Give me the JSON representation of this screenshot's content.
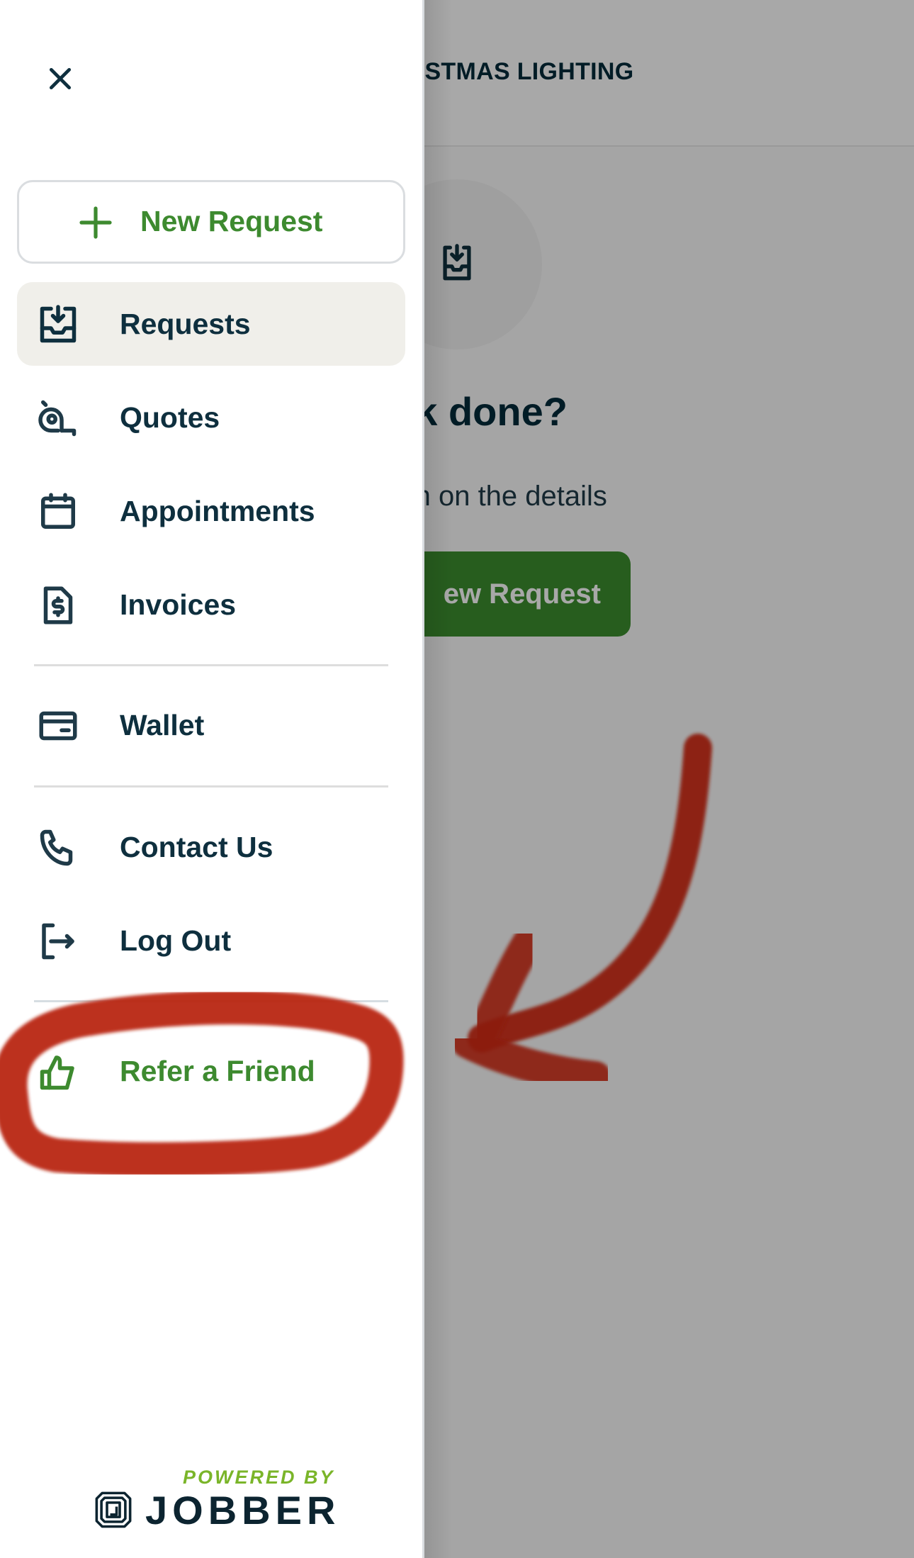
{
  "background_page": {
    "header_title": "HRISTMAS LIGHTING",
    "empty_state": {
      "icon": "inbox-download-icon",
      "title": "e work done?",
      "subtitle": "to fill us in on the details",
      "button_label": "ew Request"
    }
  },
  "drawer": {
    "close_icon": "close-icon",
    "new_request": {
      "icon": "plus-icon",
      "label": "New Request"
    },
    "nav_items": [
      {
        "id": "requests",
        "label": "Requests",
        "icon": "inbox-download-icon",
        "active": true
      },
      {
        "id": "quotes",
        "label": "Quotes",
        "icon": "tape-measure-icon",
        "active": false
      },
      {
        "id": "appointments",
        "label": "Appointments",
        "icon": "calendar-icon",
        "active": false
      },
      {
        "id": "invoices",
        "label": "Invoices",
        "icon": "invoice-dollar-icon",
        "active": false
      },
      {
        "id": "wallet",
        "label": "Wallet",
        "icon": "credit-card-icon",
        "active": false
      },
      {
        "id": "contact",
        "label": "Contact Us",
        "icon": "phone-icon",
        "active": false
      },
      {
        "id": "logout",
        "label": "Log Out",
        "icon": "logout-icon",
        "active": false
      },
      {
        "id": "refer",
        "label": "Refer a Friend",
        "icon": "thumbs-up-icon",
        "active": false
      }
    ],
    "footer": {
      "powered_by": "POWERED BY",
      "brand": "JOBBER",
      "logo_icon": "jobber-logo-icon"
    }
  },
  "colors": {
    "brand_green": "#3d8a2f",
    "text_dark": "#0e2f3e",
    "active_bg": "#f0efea",
    "powered_by_green": "#7ab529",
    "annotation_red": "#b82010"
  },
  "annotations": {
    "highlight": "red hand-drawn circle around Refer a Friend",
    "arrow": "red hand-drawn arrow pointing to Refer a Friend"
  }
}
